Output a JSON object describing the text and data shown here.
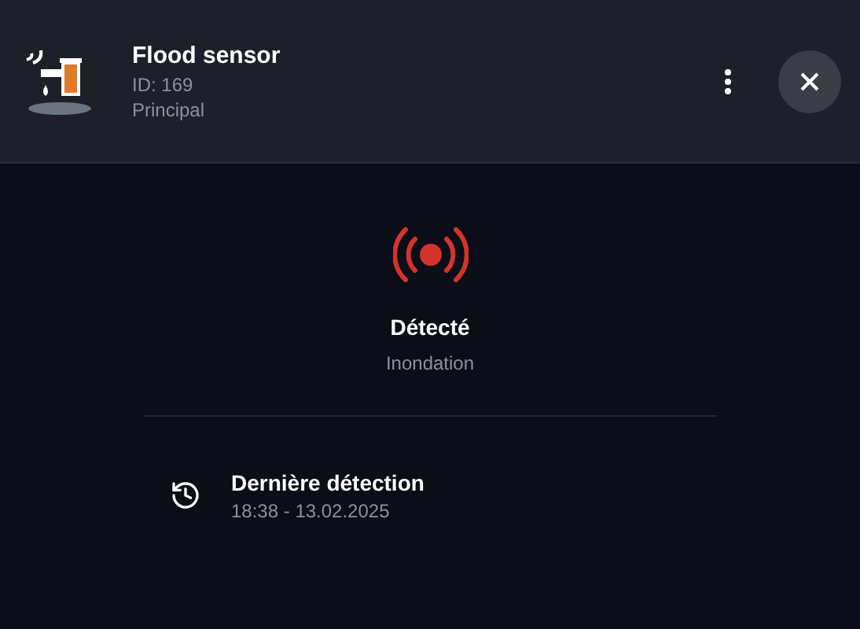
{
  "device": {
    "name": "Flood sensor",
    "id": "ID: 169",
    "room": "Principal"
  },
  "status": {
    "kind": "alarm",
    "label": "Détecté",
    "sublabel": "Inondation"
  },
  "details": [
    {
      "label": "Dernière détection",
      "value": "18:38 - 13.02.2025"
    }
  ]
}
